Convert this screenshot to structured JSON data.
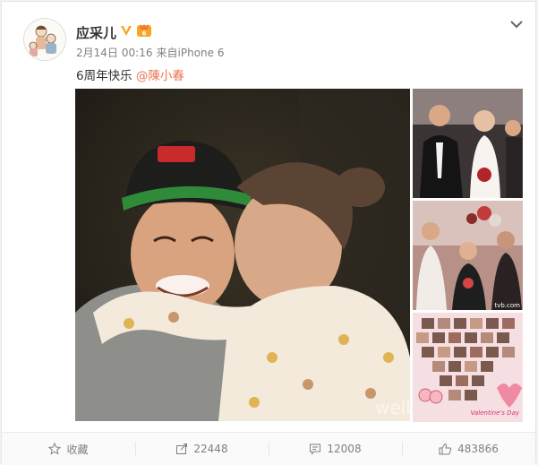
{
  "user": {
    "name": "应采儿",
    "avatar_icon": "cartoon-avatar-icon",
    "verified_icon": "verified-v-icon",
    "level_icon": "vip-level-icon"
  },
  "post": {
    "date": "2月14日",
    "time": "00:16",
    "source_prefix": "来自",
    "source": "iPhone 6",
    "text": "6周年快乐",
    "mention": "@陳小春"
  },
  "images": {
    "main_watermark": "weib",
    "side2_watermark": "tvb.com",
    "side3_text": "Valentine's Day"
  },
  "actions": {
    "favorite_label": "收藏",
    "repost_count": "22448",
    "comment_count": "12008",
    "like_count": "483866"
  },
  "colors": {
    "mention": "#eb7350",
    "verified": "#f6a623"
  }
}
